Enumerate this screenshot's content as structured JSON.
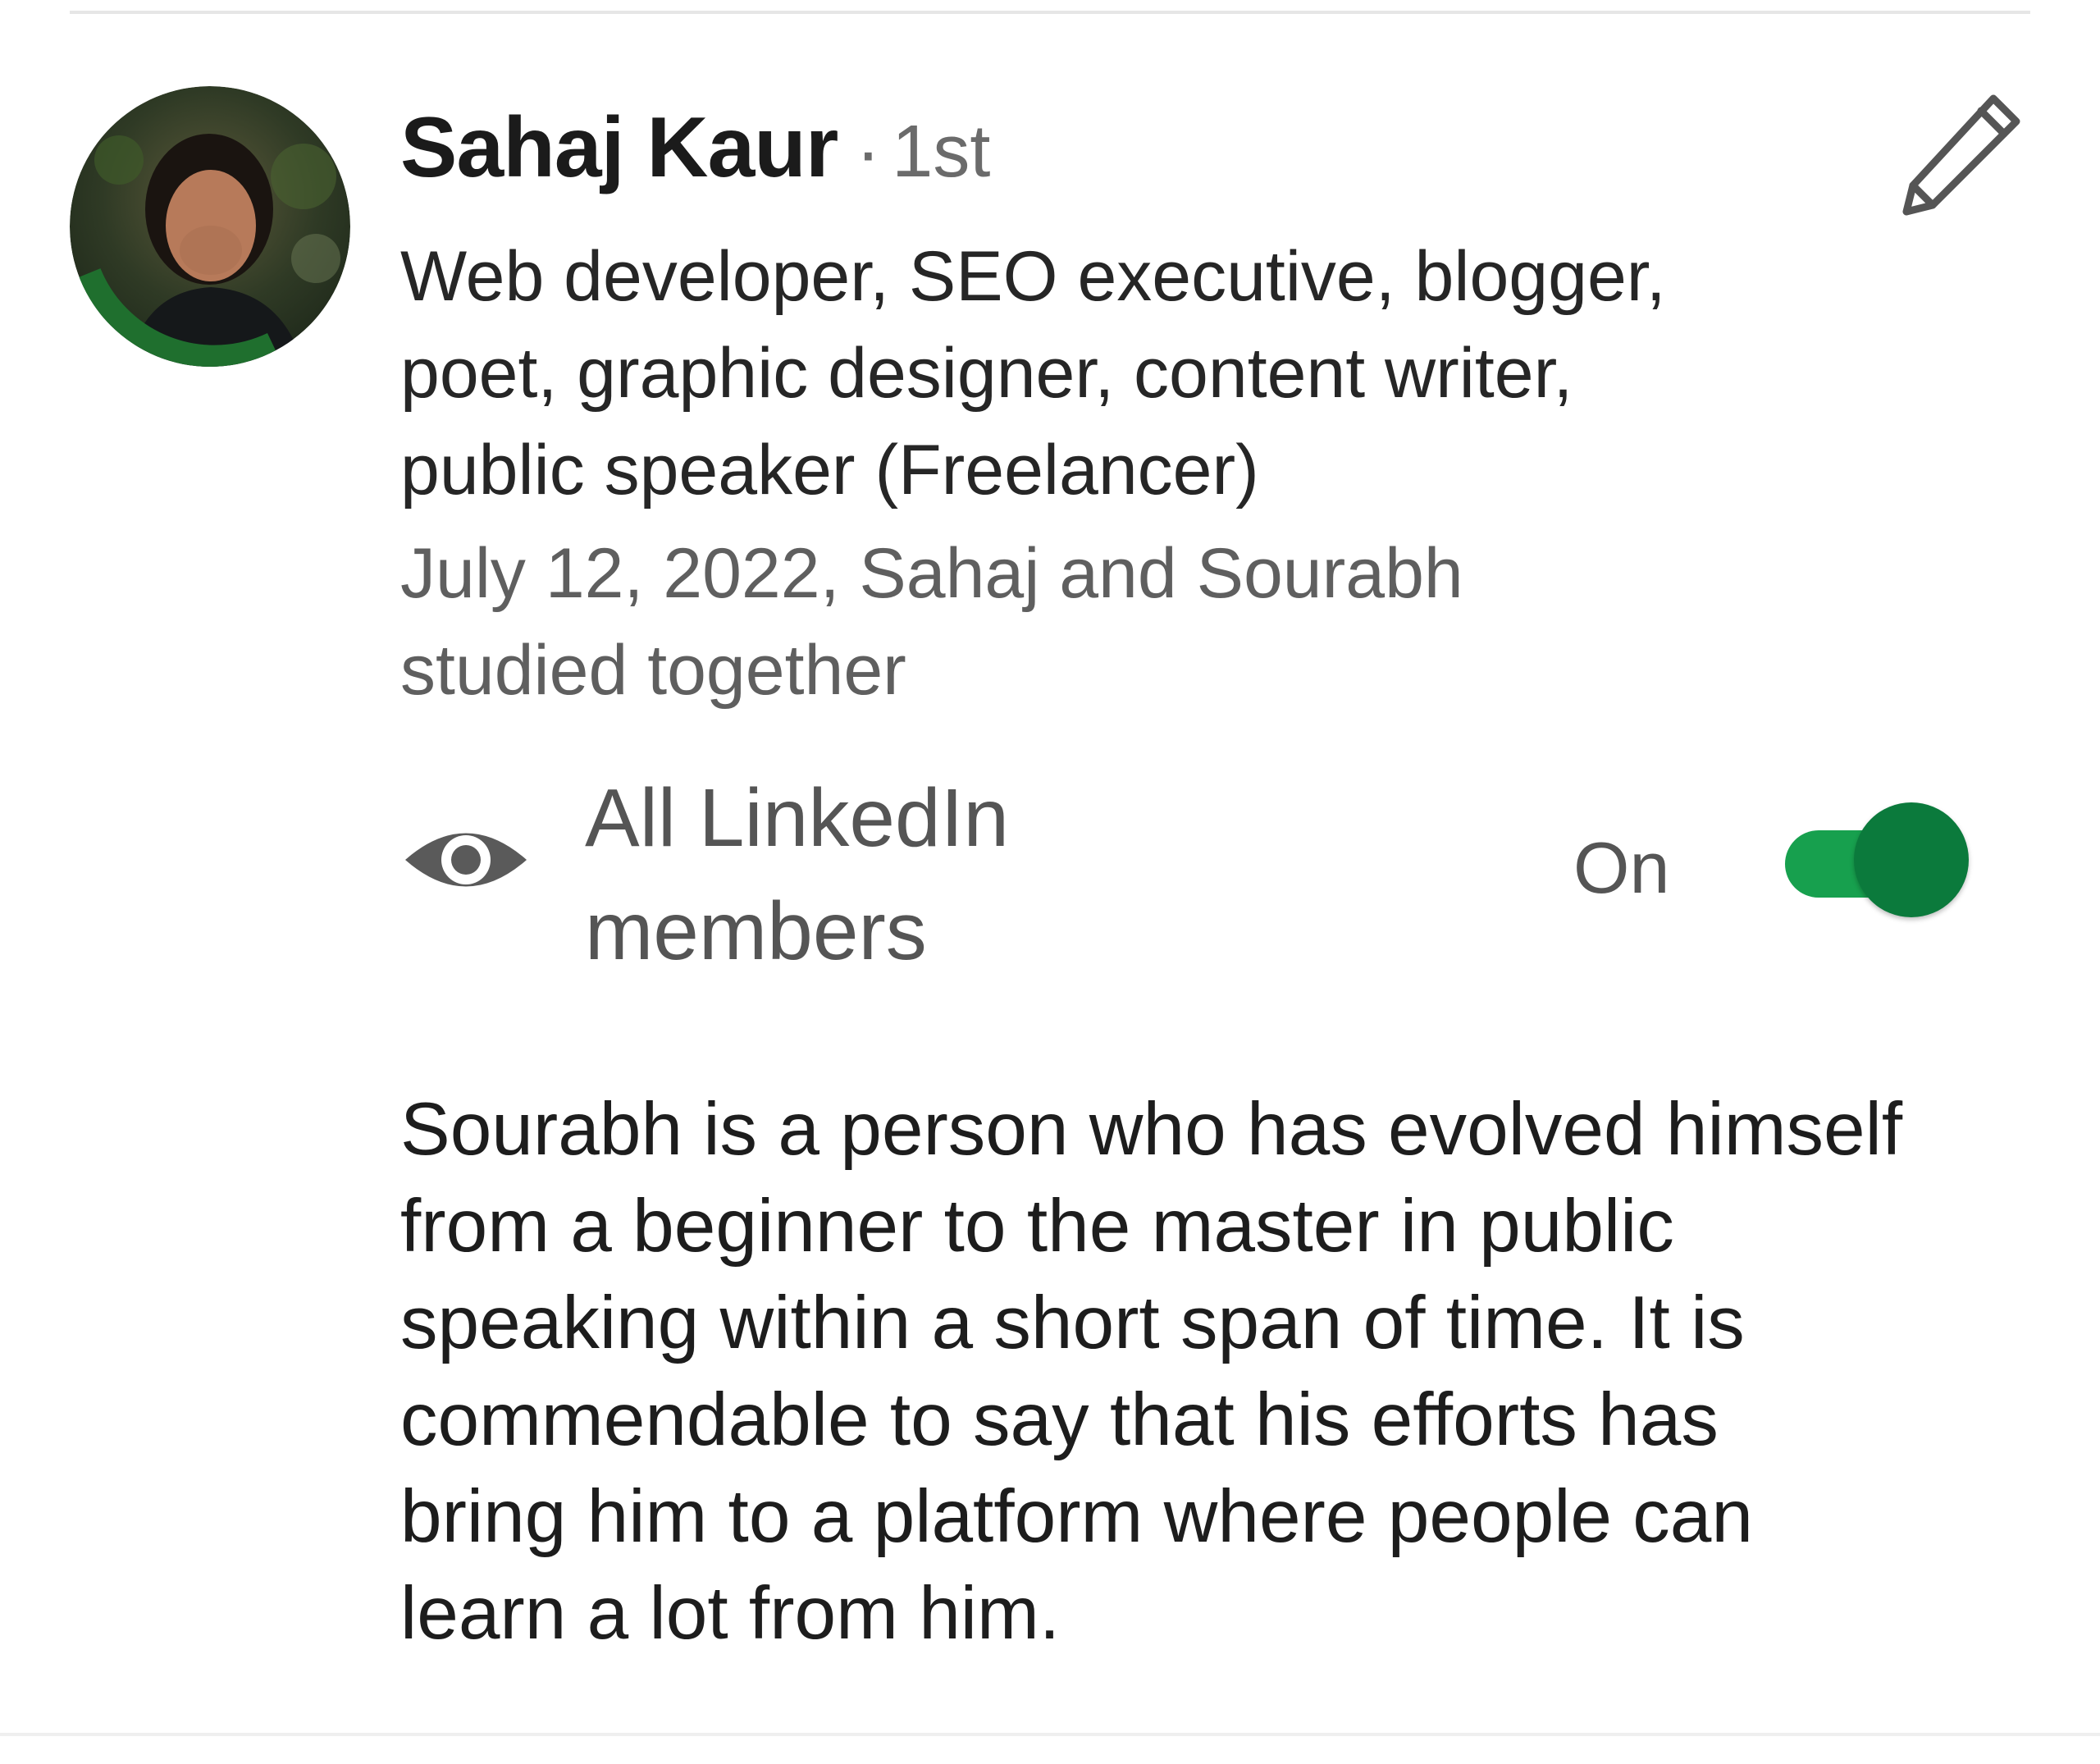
{
  "recommender": {
    "name": "Sahaj Kaur",
    "separator": "·",
    "degree": "1st",
    "avatar_badge": "#OPENTOWORK",
    "headline_lines": [
      "Web developer, SEO executive, blogger,",
      "poet, graphic designer, content writer,",
      "public speaker (Freelancer)"
    ],
    "meta_lines": [
      "July 12, 2022, Sahaj and Sourabh",
      "studied together"
    ]
  },
  "edit_icon": "pencil-icon",
  "visibility": {
    "icon": "eye-icon",
    "label_lines": [
      "All LinkedIn",
      "members"
    ],
    "state_label": "On",
    "toggle_on": true,
    "toggle_color": "#17a04e",
    "knob_color": "#0b7a3c"
  },
  "recommendation_lines": [
    "Sourabh is a person who has evolved himself",
    "from a beginner to the master in public",
    "speaking within a short span of time. It is",
    "commendable to say that his efforts has",
    "bring him to a platform where people can",
    "learn a lot from him."
  ]
}
